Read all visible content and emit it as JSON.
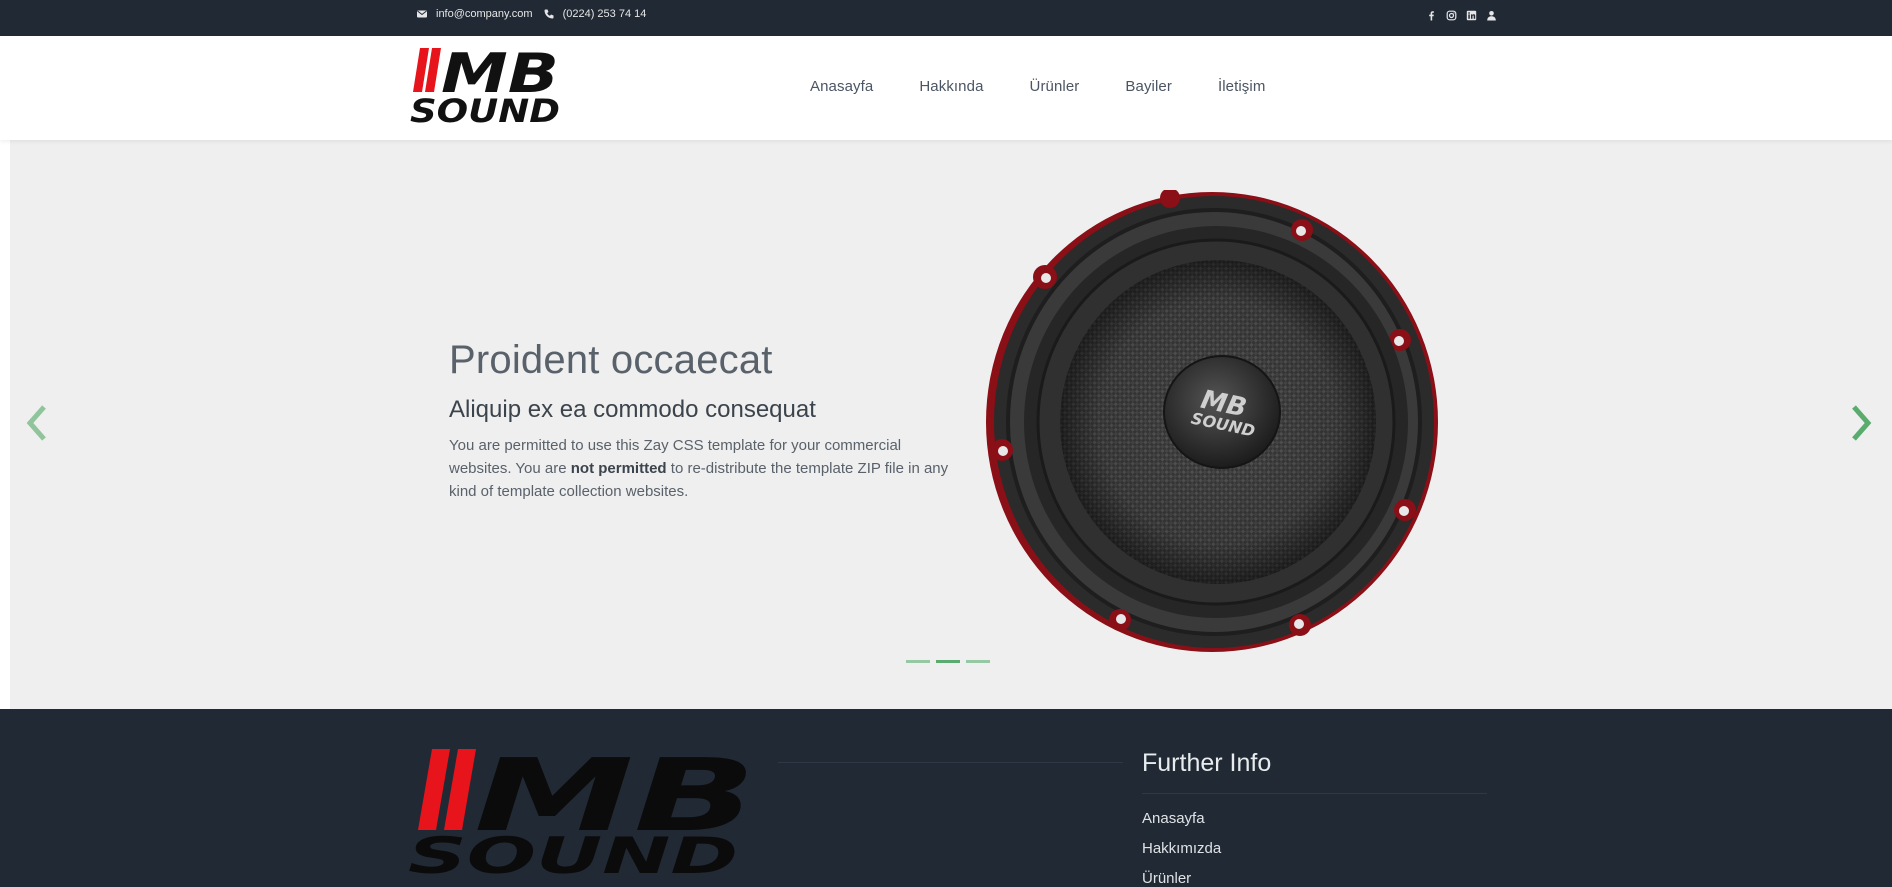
{
  "topbar": {
    "email": "info@company.com",
    "phone": "(0224) 253 74 14",
    "email_icon": "envelope-icon",
    "phone_icon": "phone-icon",
    "social": [
      "facebook-icon",
      "instagram-icon",
      "linkedin-icon",
      "user-icon"
    ]
  },
  "header": {
    "logo_line1": "MB",
    "logo_line2": "SOUND",
    "nav": [
      "Anasayfa",
      "Hakkında",
      "Ürünler",
      "Bayiler",
      "İletişim"
    ]
  },
  "hero": {
    "title": "Proident occaecat",
    "subtitle": "Aliquip ex ea commodo consequat",
    "desc_part1": "You are permitted to use this Zay CSS template for your commercial websites. You are ",
    "desc_bold": "not permitted",
    "desc_part2": " to re-distribute the template ZIP file in any kind of template collection websites.",
    "speaker_logo_line1": "MB",
    "speaker_logo_line2": "SOUND",
    "active_slide": 2,
    "slide_count": 3
  },
  "footer": {
    "logo_line1": "MB",
    "logo_line2": "SOUND",
    "further_title": "Further Info",
    "links": [
      "Anasayfa",
      "Hakkımızda",
      "Ürünler"
    ]
  },
  "colors": {
    "dark": "#212934",
    "accent": "#59ab6e",
    "logo_red": "#e8141c",
    "hero_bg": "#efefef"
  }
}
